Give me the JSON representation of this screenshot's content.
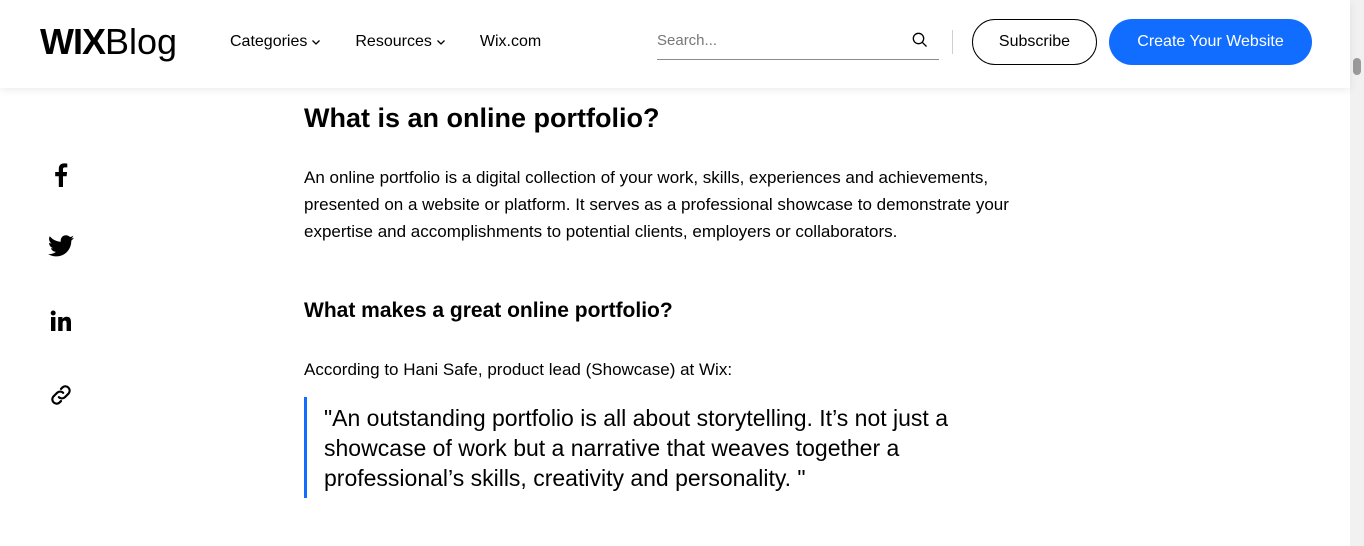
{
  "header": {
    "logo_wix": "WIX",
    "logo_blog": "Blog",
    "nav": [
      {
        "label": "Categories",
        "has_dropdown": true
      },
      {
        "label": "Resources",
        "has_dropdown": true
      },
      {
        "label": "Wix.com",
        "has_dropdown": false
      }
    ],
    "search": {
      "placeholder": "Search...",
      "icon": "search-icon"
    },
    "subscribe_label": "Subscribe",
    "create_label": "Create Your Website",
    "accent_color": "#116dff"
  },
  "share": {
    "items": [
      {
        "name": "facebook",
        "icon": "facebook-icon"
      },
      {
        "name": "twitter",
        "icon": "twitter-icon"
      },
      {
        "name": "linkedin",
        "icon": "linkedin-icon"
      },
      {
        "name": "copy-link",
        "icon": "link-icon"
      }
    ]
  },
  "article": {
    "heading": "What is an online portfolio?",
    "paragraph": "An online portfolio is a digital collection of your work, skills, experiences and achievements, presented on a website or platform. It serves as a professional showcase to demonstrate your expertise and accomplishments to potential clients, employers or collaborators.",
    "subheading": "What makes a great online portfolio?",
    "attribution": "According to Hani Safe, product lead (Showcase) at Wix:",
    "quote": "\"An outstanding portfolio is all about storytelling. It’s not just a showcase of work but a narrative that weaves together a professional’s skills, creativity and personality. \""
  }
}
